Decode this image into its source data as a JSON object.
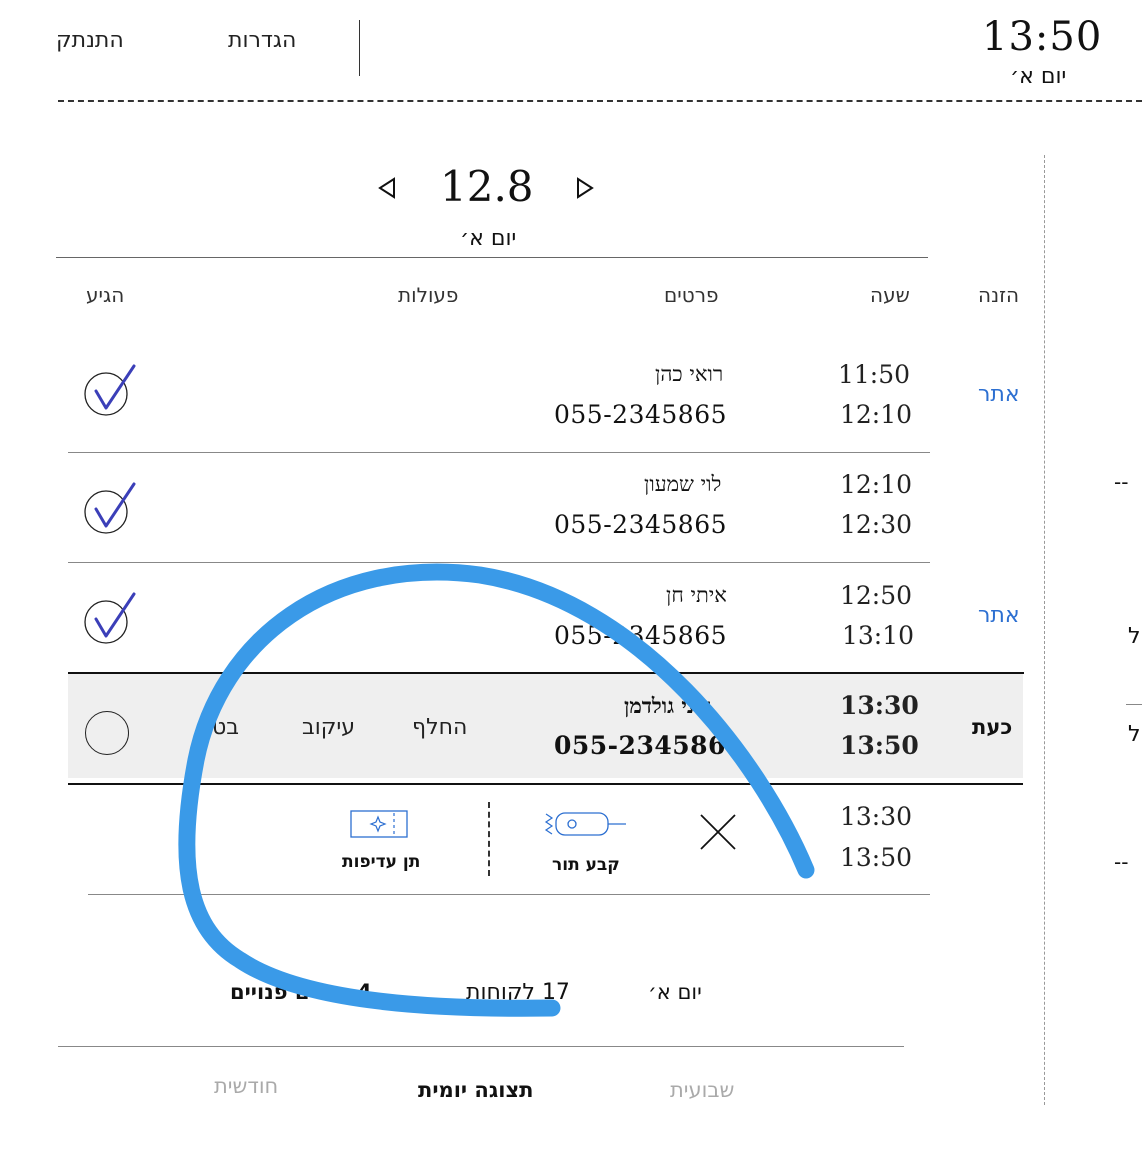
{
  "header": {
    "clock": "13:50",
    "day": "יום א׳",
    "settings": "הגדרות",
    "logout": "התנתק"
  },
  "date_nav": {
    "date": "12.8",
    "day": "יום א׳"
  },
  "columns": {
    "arrived": "הגיע",
    "actions": "פעולות",
    "details": "פרטים",
    "time": "שעה",
    "source": "הזנה"
  },
  "appointments": [
    {
      "start": "11:50",
      "end": "12:10",
      "name": "רואי כהן",
      "phone": "055-2345865",
      "source": "אתר",
      "arrived": true
    },
    {
      "start": "12:10",
      "end": "12:30",
      "name": "לוי שמעון",
      "phone": "055-2345865",
      "source": "",
      "arrived": true
    },
    {
      "start": "12:50",
      "end": "13:10",
      "name": "איתי חן",
      "phone": "055-2345865",
      "source": "אתר",
      "arrived": true
    },
    {
      "start": "13:30",
      "end": "13:50",
      "name": "חוני גולדמן",
      "phone": "055-234586",
      "source": "כעת",
      "arrived": false,
      "actions": {
        "replace": "החלף",
        "delay": "עיקוב",
        "cancel": "בט"
      }
    }
  ],
  "empty_slot": {
    "start": "13:30",
    "end": "13:50",
    "book": "קבע תור",
    "priority": "תן עדיפות"
  },
  "summary": {
    "day": "יום א׳",
    "clients": "17 לקוחות",
    "free": "4 תורים פנויים"
  },
  "tabs": {
    "monthly": "חודשית",
    "daily": "תצוגה יומית",
    "weekly": "שבועית"
  },
  "side_fragments": {
    "dash1": "--",
    "dash2": "--",
    "frag1": "ל",
    "frag2": "ל"
  },
  "colors": {
    "link": "#2c6fd1",
    "check": "#3b3fb8",
    "highlight_row": "#efefef",
    "scribble": "#3a9ae8"
  }
}
